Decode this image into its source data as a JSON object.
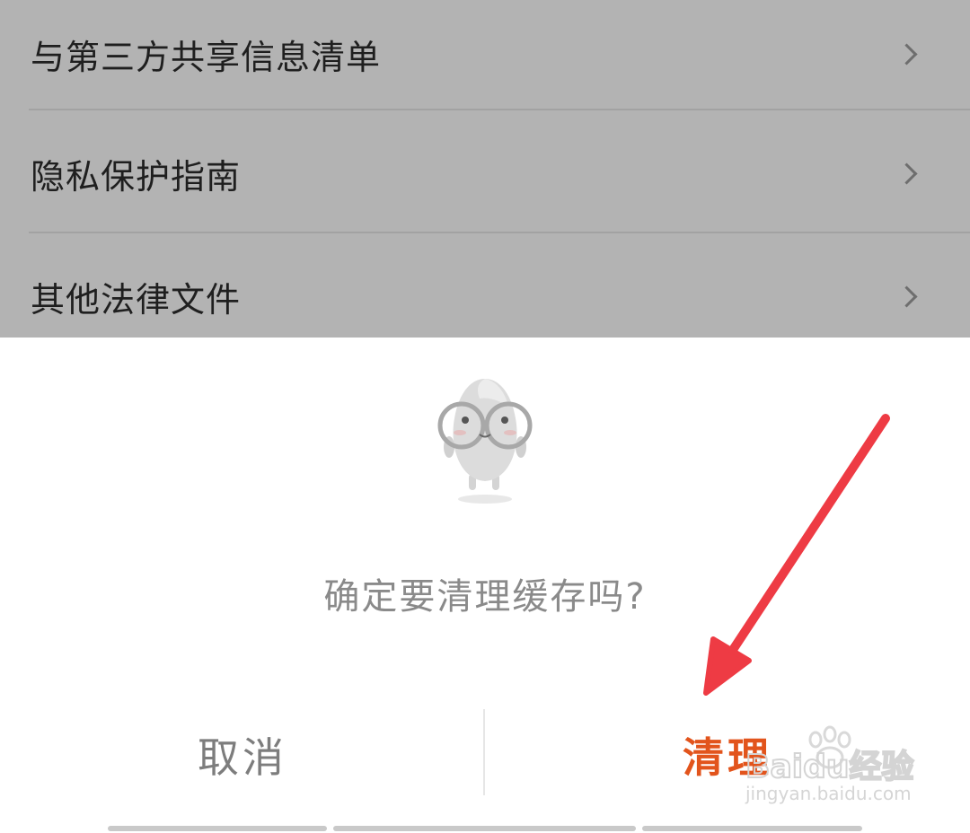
{
  "settings": {
    "items": [
      {
        "label": "与第三方共享信息清单"
      },
      {
        "label": "隐私保护指南"
      },
      {
        "label": "其他法律文件"
      }
    ]
  },
  "dialog": {
    "message": "确定要清理缓存吗?",
    "cancel_label": "取消",
    "confirm_label": "清理"
  },
  "watermark": {
    "brand": "Baidu经验",
    "url": "jingyan.baidu.com"
  },
  "colors": {
    "confirm": "#e2541c",
    "cancel": "#7d7d7d",
    "overlay": "#b3b3b3",
    "annotation_arrow": "#ee3b44"
  },
  "icons": {
    "mascot": "glasses-mascot-icon",
    "row_chevron": "chevron-right-icon"
  }
}
